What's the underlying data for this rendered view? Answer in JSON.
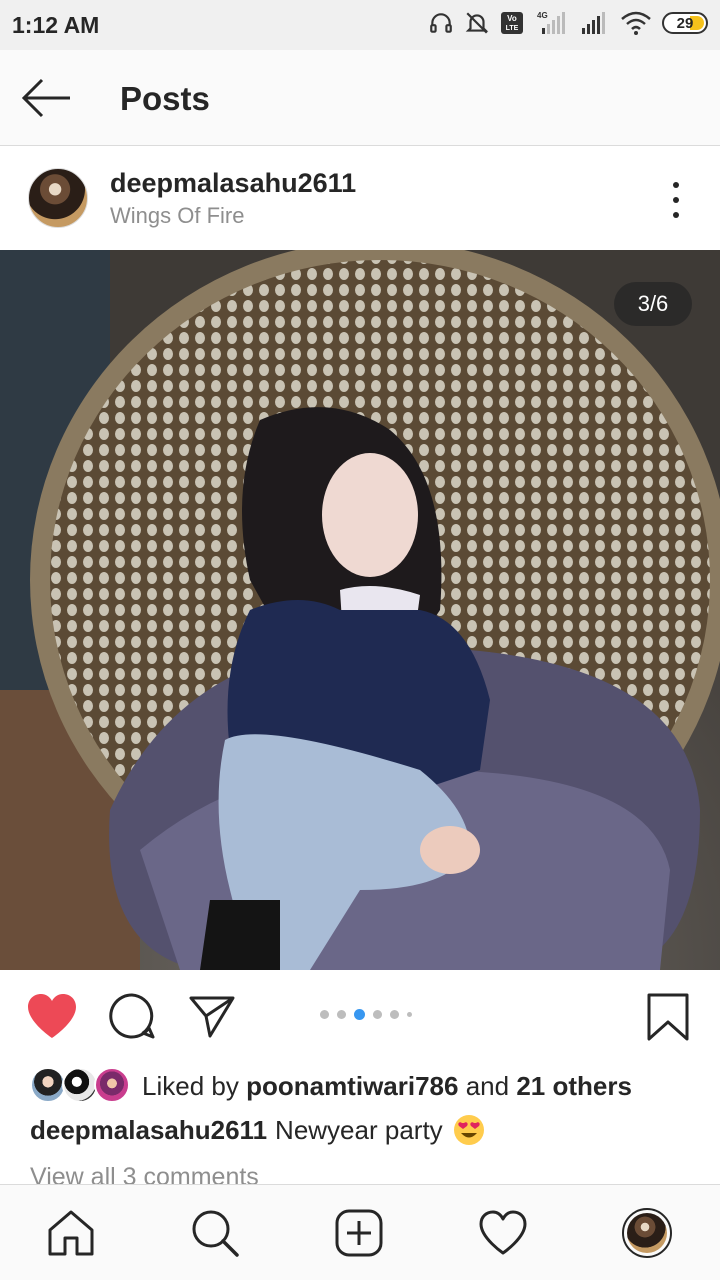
{
  "status_bar": {
    "time": "1:12 AM",
    "network_label": "4G",
    "volte_label": "Vo LTE",
    "battery_level": "29",
    "icons": [
      "headphones-icon",
      "mute-icon",
      "volte-icon",
      "signal-icon",
      "signal-icon",
      "wifi-icon",
      "battery-icon"
    ]
  },
  "header": {
    "title": "Posts",
    "back_icon": "arrow-left-icon"
  },
  "post": {
    "username": "deepmalasahu2611",
    "location": "Wings Of Fire",
    "image_counter": "3/6",
    "image_index": 3,
    "image_total": 6,
    "liked": true,
    "likes": {
      "prefix": "Liked by",
      "user": "poonamtiwari786",
      "connector": "and",
      "others": "21 others"
    },
    "caption": {
      "username": "deepmalasahu2611",
      "text": "Newyear party"
    },
    "comments_link": "View all 3 comments"
  },
  "actions": {
    "icons": [
      "heart-filled-icon",
      "comment-icon",
      "share-icon",
      "bookmark-icon"
    ]
  },
  "bottom_nav": {
    "icons": [
      "home-icon",
      "search-icon",
      "add-post-icon",
      "heart-outline-icon",
      "profile-avatar"
    ]
  },
  "colors": {
    "like_red": "#ed4956",
    "active_dot": "#3897f0",
    "text_primary": "#262626",
    "text_secondary": "#8e8e8e"
  }
}
